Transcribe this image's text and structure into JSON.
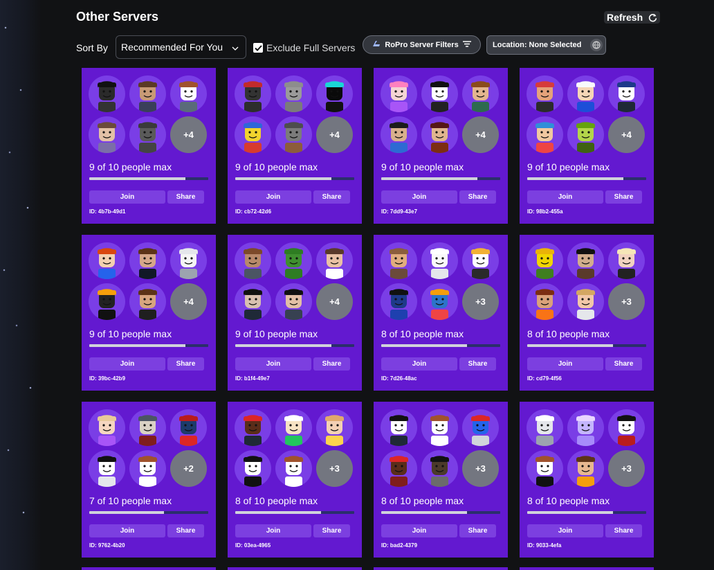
{
  "header": {
    "title": "Other Servers",
    "refresh_label": "Refresh",
    "refresh_icon": "refresh-icon"
  },
  "controls": {
    "sort_label": "Sort By",
    "sort_value": "Recommended For You",
    "exclude_label": "Exclude Full Servers",
    "exclude_checked": true,
    "filters_label": "RoPro Server Filters",
    "location_label": "Location: None Selected"
  },
  "card_labels": {
    "join": "Join",
    "share": "Share"
  },
  "colors": {
    "card_bg": "#6319d0",
    "button_bg": "#7c3fe0",
    "avatar_bg": "#7a3ee6",
    "more_bg": "#737680",
    "bar_track": "#2b2f6b",
    "bar_fill": "#d0d2da"
  },
  "servers": [
    {
      "people": "9 of 10 people max",
      "fill": 0.9,
      "more": "+4",
      "id": "ID: 4b7b-49d1",
      "avatars": [
        {
          "skin": "#2a2a2a",
          "hair": "#111111",
          "shirt": "#333333"
        },
        {
          "skin": "#c89a76",
          "hair": "#5b3a24",
          "shirt": "#3a3f5a"
        },
        {
          "skin": "#ffffff",
          "hair": "#a0522d",
          "shirt": "#5a6b7a"
        },
        {
          "skin": "#e3c1a6",
          "hair": "#6b4a3a",
          "shirt": "#7b6ea8"
        },
        {
          "skin": "#5a5a5a",
          "hair": "#3a3a3a",
          "shirt": "#444444"
        }
      ]
    },
    {
      "people": "9 of 10 people max",
      "fill": 0.9,
      "more": "+4",
      "id": "ID: cb72-42d6",
      "avatars": [
        {
          "skin": "#333333",
          "hair": "#c22b2b",
          "shirt": "#2d2d2d"
        },
        {
          "skin": "#9a9a9a",
          "hair": "#8d8d8d",
          "shirt": "#7b7b7b"
        },
        {
          "skin": "#0a0a0a",
          "hair": "#1ad6d6",
          "shirt": "#111111"
        },
        {
          "skin": "#f2d32e",
          "hair": "#2f66d9",
          "shirt": "#d83b2e"
        },
        {
          "skin": "#7b7b7b",
          "hair": "#4d4d4d",
          "shirt": "#8c5c3c"
        }
      ]
    },
    {
      "people": "9 of 10 people max",
      "fill": 0.9,
      "more": "+4",
      "id": "ID: 7dd9-43e7",
      "avatars": [
        {
          "skin": "#f5d4d4",
          "hair": "#ff80bf",
          "shirt": "#a855f7"
        },
        {
          "skin": "#ffffff",
          "hair": "#111111",
          "shirt": "#222222"
        },
        {
          "skin": "#e3b58f",
          "hair": "#8a4b1c",
          "shirt": "#2d6a4f"
        },
        {
          "skin": "#d8b08c",
          "hair": "#1b1b1b",
          "shirt": "#2d6ad3"
        },
        {
          "skin": "#e0b58f",
          "hair": "#551616",
          "shirt": "#7c2d12"
        }
      ]
    },
    {
      "people": "9 of 10 people max",
      "fill": 0.9,
      "more": "+4",
      "id": "ID: 98b2-455a",
      "avatars": [
        {
          "skin": "#e5a27a",
          "hair": "#d63b3b",
          "shirt": "#2b2b2b"
        },
        {
          "skin": "#f5d6b6",
          "hair": "#f8fafc",
          "shirt": "#1d4ed8"
        },
        {
          "skin": "#ffffff",
          "hair": "#1e3a8a",
          "shirt": "#1f2937"
        },
        {
          "skin": "#f0c8a0",
          "hair": "#2f8fd8",
          "shirt": "#ef4444"
        },
        {
          "skin": "#b3d64a",
          "hair": "#65a30d",
          "shirt": "#3f6212"
        }
      ]
    },
    {
      "people": "9 of 10 people max",
      "fill": 0.9,
      "more": "+4",
      "id": "ID: 39bc-42b9",
      "avatars": [
        {
          "skin": "#f3d1b0",
          "hair": "#d9480f",
          "shirt": "#2563eb"
        },
        {
          "skin": "#d5a78a",
          "hair": "#5c3317",
          "shirt": "#111827"
        },
        {
          "skin": "#f5f5f5",
          "hair": "#e5e7eb",
          "shirt": "#9ca3af"
        },
        {
          "skin": "#222222",
          "hair": "#f59e0b",
          "shirt": "#111111"
        },
        {
          "skin": "#d7a57f",
          "hair": "#5c3317",
          "shirt": "#1f1f1f"
        }
      ]
    },
    {
      "people": "9 of 10 people max",
      "fill": 0.9,
      "more": "+4",
      "id": "ID: b1f4-49e7",
      "avatars": [
        {
          "skin": "#b7896a",
          "hair": "#7c4a2a",
          "shirt": "#4b5563"
        },
        {
          "skin": "#3f8f2f",
          "hair": "#2e7d22",
          "shirt": "#2e7d22"
        },
        {
          "skin": "#e9c1a4",
          "hair": "#5a3a2a",
          "shirt": "#ffffff"
        },
        {
          "skin": "#d8c0b0",
          "hair": "#111111",
          "shirt": "#1f2937"
        },
        {
          "skin": "#e2bfa5",
          "hair": "#111111",
          "shirt": "#374151"
        }
      ]
    },
    {
      "people": "8 of 10 people max",
      "fill": 0.8,
      "more": "+3",
      "id": "ID: 7d26-48ac",
      "avatars": [
        {
          "skin": "#e0ac7e",
          "hair": "#8b5e3c",
          "shirt": "#6b4a3a"
        },
        {
          "skin": "#fafafa",
          "hair": "#ffffff",
          "shirt": "#e5e7eb"
        },
        {
          "skin": "#ffffff",
          "hair": "#f2b134",
          "shirt": "#2a2a2a"
        },
        {
          "skin": "#1e3a8a",
          "hair": "#111111",
          "shirt": "#1e40af"
        },
        {
          "skin": "#2c74c9",
          "hair": "#f59e0b",
          "shirt": "#ef4444"
        }
      ]
    },
    {
      "people": "8 of 10 people max",
      "fill": 0.8,
      "more": "+3",
      "id": "ID: cd79-4f56",
      "avatars": [
        {
          "skin": "#f0d500",
          "hair": "#eab308",
          "shirt": "#3f7f1f"
        },
        {
          "skin": "#d1ad8c",
          "hair": "#111111",
          "shirt": "#5a3a2a"
        },
        {
          "skin": "#f1d2c0",
          "hair": "#f5e6b8",
          "shirt": "#222222"
        },
        {
          "skin": "#d9a17a",
          "hair": "#7c2d12",
          "shirt": "#f97316"
        },
        {
          "skin": "#f1c7a8",
          "hair": "#d4a762",
          "shirt": "#e5e7eb"
        }
      ]
    },
    {
      "people": "7 of 10 people max",
      "fill": 0.7,
      "more": "+2",
      "id": "ID: 9762-4b20",
      "avatars": [
        {
          "skin": "#f5d6c0",
          "hair": "#e8c99a",
          "shirt": "#a855f7"
        },
        {
          "skin": "#d9d2c5",
          "hair": "#4b5563",
          "shirt": "#7f1d1d"
        },
        {
          "skin": "#1d3b6b",
          "hair": "#b91c1c",
          "shirt": "#dc2626"
        },
        {
          "skin": "#ffffff",
          "hair": "#111111",
          "shirt": "#e5e7eb"
        },
        {
          "skin": "#ffffff",
          "hair": "#a0522d",
          "shirt": "#ffffff"
        }
      ]
    },
    {
      "people": "8 of 10 people max",
      "fill": 0.8,
      "more": "+3",
      "id": "ID: 03ea-4965",
      "avatars": [
        {
          "skin": "#5a2d1a",
          "hair": "#dc2626",
          "shirt": "#1f2937"
        },
        {
          "skin": "#f7e3c4",
          "hair": "#ffffff",
          "shirt": "#22c55e"
        },
        {
          "skin": "#f3d0b4",
          "hair": "#e0a96d",
          "shirt": "#fcd34d"
        },
        {
          "skin": "#ffffff",
          "hair": "#111111",
          "shirt": "#111111"
        },
        {
          "skin": "#ffffff",
          "hair": "#a0522d",
          "shirt": "#ffffff"
        }
      ]
    },
    {
      "people": "8 of 10 people max",
      "fill": 0.8,
      "more": "+3",
      "id": "ID: bad2-4379",
      "avatars": [
        {
          "skin": "#ffffff",
          "hair": "#111111",
          "shirt": "#1f2937"
        },
        {
          "skin": "#ffffff",
          "hair": "#a0522d",
          "shirt": "#ffffff"
        },
        {
          "skin": "#2563eb",
          "hair": "#dc2626",
          "shirt": "#d1d5db"
        },
        {
          "skin": "#5a2d1a",
          "hair": "#dc2626",
          "shirt": "#7f1d1d"
        },
        {
          "skin": "#4b3a2a",
          "hair": "#111111",
          "shirt": "#6b6b6b"
        }
      ]
    },
    {
      "people": "8 of 10 people max",
      "fill": 0.8,
      "more": "+3",
      "id": "ID: 9033-4efa",
      "avatars": [
        {
          "skin": "#e5e7eb",
          "hair": "#ffffff",
          "shirt": "#9ca3af"
        },
        {
          "skin": "#c4b5fd",
          "hair": "#e9d5ff",
          "shirt": "#a78bfa"
        },
        {
          "skin": "#ffffff",
          "hair": "#111111",
          "shirt": "#b91c1c"
        },
        {
          "skin": "#ffffff",
          "hair": "#a0522d",
          "shirt": "#111111"
        },
        {
          "skin": "#e7b78f",
          "hair": "#5c3317",
          "shirt": "#f59e0b"
        }
      ]
    }
  ]
}
